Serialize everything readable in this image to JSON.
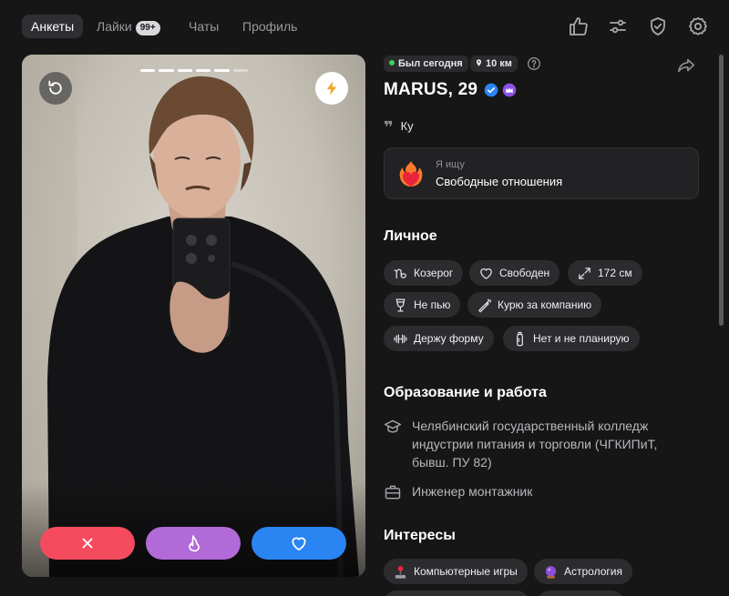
{
  "nav": {
    "tabs": [
      {
        "label": "Анкеты",
        "active": true
      },
      {
        "label": "Лайки",
        "badge": "99+"
      },
      {
        "label": "Чаты"
      },
      {
        "label": "Профиль"
      }
    ],
    "icons": [
      "thumbs-up-icon",
      "sliders-icon",
      "shield-check-icon",
      "gear-icon"
    ]
  },
  "photo": {
    "progress_total": 6,
    "progress_active": 5,
    "actions": [
      "dislike",
      "superlike",
      "like"
    ]
  },
  "profile": {
    "last_seen": "Был сегодня",
    "distance": "10 км",
    "name_age": "MARUS, 29",
    "quote": "Ку",
    "seeking": {
      "label": "Я ищу",
      "value": "Свободные отношения"
    },
    "personal_title": "Личное",
    "personal_tags": [
      {
        "label": "Козерог",
        "icon": "capricorn-icon"
      },
      {
        "label": "Свободен",
        "icon": "heart-outline-icon"
      },
      {
        "label": "172 см",
        "icon": "height-icon"
      },
      {
        "label": "Не пью",
        "icon": "glass-icon"
      },
      {
        "label": "Курю за компанию",
        "icon": "cigarette-icon"
      },
      {
        "label": "Держу форму",
        "icon": "dumbbell-icon"
      },
      {
        "label": "Нет и не планирую",
        "icon": "baby-bottle-icon"
      }
    ],
    "education_title": "Образование и работа",
    "education": "Челябинский государственный колледж индустрии питания и торговли (ЧГКИПиТ, бывш. ПУ 82)",
    "job": "Инженер монтажник",
    "interests_title": "Интересы",
    "interests": [
      {
        "label": "Компьютерные игры",
        "icon": "joystick-icon"
      },
      {
        "label": "Астрология",
        "icon": "crystal-ball-icon"
      }
    ]
  },
  "colors": {
    "background": "#161617",
    "chip": "#2c2c2f",
    "dislike": "#f54b5e",
    "superlike": "#b16ad8",
    "like": "#2a84f2",
    "online": "#3ecf5a",
    "boost": "#f5a623"
  }
}
